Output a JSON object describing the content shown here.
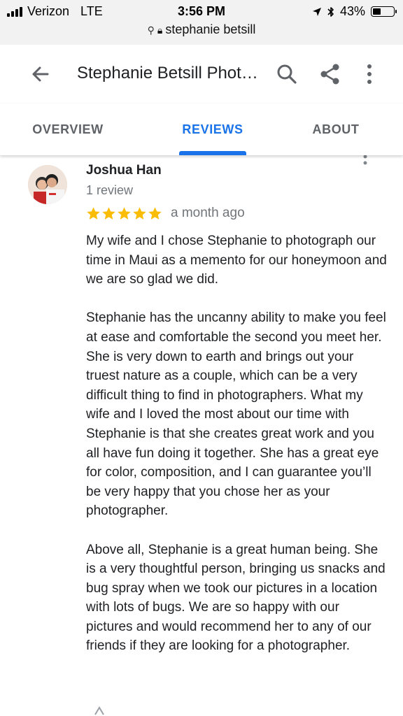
{
  "status": {
    "carrier": "Verizon",
    "network": "LTE",
    "time": "3:56 PM",
    "battery": "43%",
    "battery_level": 0.43
  },
  "url": {
    "text": "stephanie betsill"
  },
  "appbar": {
    "title": "Stephanie Betsill Phot…"
  },
  "tabs": [
    {
      "label": "OVERVIEW",
      "active": false
    },
    {
      "label": "REVIEWS",
      "active": true
    },
    {
      "label": "ABOUT",
      "active": false
    }
  ],
  "review": {
    "author": "Joshua Han",
    "count": "1 review",
    "rating": 5,
    "date": "a month ago",
    "paragraphs": [
      "My wife and I chose Stephanie to photograph our time in Maui as a memento for our honeymoon and we are so glad we did.",
      "Stephanie has the uncanny ability to make you feel at ease and comfortable the second you meet her. She is very down to earth and brings out your truest nature as a couple, which can be a very difficult thing to find in photographers. What my wife and I loved the most about our time with Stephanie is that she creates great work and you all have fun doing it together. She has a great eye for color, composition, and I can guarantee you’ll be very happy that you chose her as your photographer.",
      "Above all, Stephanie is a great human being. She is a very thoughtful person, bringing us snacks and bug spray when we took our pictures in a location with lots of bugs. We are so happy with our pictures and would recommend her to any of our friends if they are looking for a photographer."
    ]
  },
  "colors": {
    "accent": "#1a73e8",
    "star": "#fbbc04",
    "muted": "#70757a"
  }
}
